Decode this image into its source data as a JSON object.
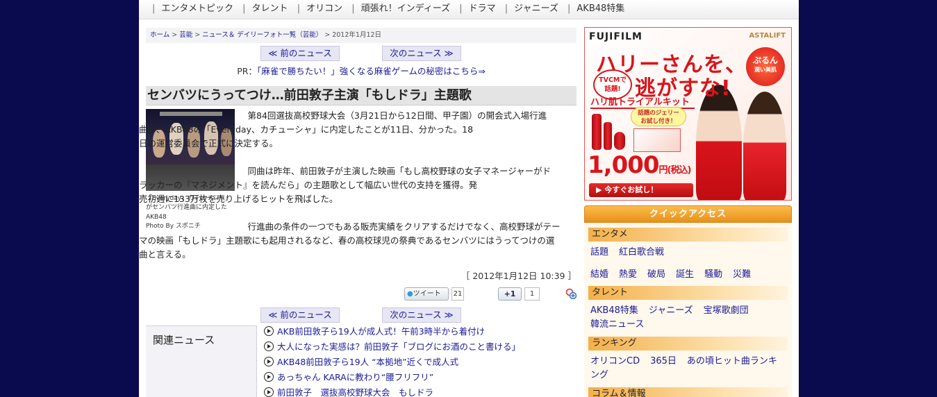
{
  "topnav": {
    "items": [
      "エンタメトピック",
      "タレント",
      "オリコン",
      "頑張れ！インディーズ",
      "ドラマ",
      "ジャニーズ",
      "AKB48特集"
    ]
  },
  "breadcrumb": {
    "home": "ホーム",
    "geino": "芸能",
    "news": "ニュース＆ デイリーフォト一覧（芸能）",
    "date": "2012年1月12日"
  },
  "pager": {
    "prev": "≪ 前のニュース",
    "next": "次のニュース ≫"
  },
  "pr": {
    "prefix": "PR：",
    "link": "「麻雀で勝ちたい！」強くなる麻雀ゲームの秘密はこちら⇒"
  },
  "article": {
    "headline": "センバツにうってつけ…前田敦子主演「もしドラ」主題歌",
    "caption": [
      "「Everyday、カチューシャ」がセンバツ行進曲に内定した",
      "AKB48",
      "Photo By スポニチ"
    ],
    "p1": [
      "　第84回選抜高校野球大会（3月21日から12日間、甲子園）の開会式入場行進",
      "曲が、AKB48の「Everyday、カチューシャ」に内定したことが11日、分かった。18",
      "日の運営委員会で正式に決定する。"
    ],
    "p2": [
      "　同曲は昨年、前田敦子が主演した映画「もし高校野球の女子マネージャーがド",
      "ラッカーの『マネジメント』を読んだら」の主題歌として幅広い世代の支持を獲得。発",
      "売初週に133万枚を売り上げるヒットを飛ばした。"
    ],
    "p3": [
      "　行進曲の条件の一つでもある販売実績をクリアするだけでなく、高校野球がテー",
      "マの映画「もしドラ」主題歌にも起用されるなど、春の高校球児の祭典であるセンバツにはうってつけの選",
      "曲と言える。"
    ],
    "date": "［ 2012年1月12日 10:39 ］"
  },
  "social": {
    "tweet_label": "ツイート",
    "tweet_count": "21",
    "plus_label": "+1",
    "plus_count": "1"
  },
  "related": {
    "title": "関連ニュース",
    "items": [
      "AKB前田敦子ら19人が成人式！午前3時半から着付け",
      "大人になった実感は？前田敦子「ブログにお酒のこと書ける」",
      "AKB48前田敦子ら19人 “本拠地”近くで成人式",
      "あっちゃん KARAに教わり“腰フリフリ”",
      "前田敦子　選抜高校野球大会　もしドラ"
    ]
  },
  "ad": {
    "brand": "FUJIFILM",
    "brand2": "ASTALIFT",
    "copy1": "ハリーさんを、",
    "copy2": "逃がすな!",
    "badge": [
      "TVCMで",
      "話題!"
    ],
    "puru": [
      "ぷるん",
      "潤い美肌"
    ],
    "kit": "ハリ肌トライアルキット",
    "jelly": [
      "話題のジェリー",
      "お試し付き！"
    ],
    "price": "1,000",
    "price_unit": "円(税込)",
    "cta": "▶ 今すぐお試し！"
  },
  "quick_access": {
    "title": "クイックアクセス",
    "sections": [
      {
        "name": "エンタメ",
        "rows": [
          [
            "話題",
            "紅白歌合戦"
          ],
          [
            "結婚",
            "熱愛",
            "破局",
            "誕生",
            "騒動",
            "災難"
          ]
        ]
      },
      {
        "name": "タレント",
        "rows": [
          [
            "AKB48特集",
            "ジャニーズ",
            "宝塚歌劇団"
          ],
          [
            "韓流ニュース"
          ]
        ]
      },
      {
        "name": "ランキング",
        "rows": [
          [
            "オリコンCD",
            "365日",
            "あの頃ヒット曲ランキ"
          ],
          [
            "ング"
          ]
        ]
      },
      {
        "name": "コラム＆情報",
        "rows": []
      }
    ]
  }
}
